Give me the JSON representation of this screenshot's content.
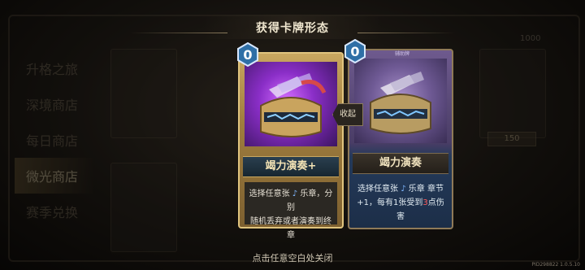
{
  "popup": {
    "title": "获得卡牌形态",
    "close_hint": "点击任意空白处关闭",
    "collapse_label": "收起"
  },
  "cards": [
    {
      "cost": "0",
      "name": "竭力演奏+",
      "description": [
        "选择任意张",
        "乐章，分别",
        "随机丢弃或者演奏到终章"
      ],
      "frame": "gold",
      "art_icon": "helmet-with-feathers"
    },
    {
      "cost": "0",
      "type_tag": "辅助牌",
      "name": "竭力演奏",
      "description": [
        "选择任意张",
        "乐章 章节",
        "+1，每有1张受到",
        "3",
        "点伤害"
      ],
      "frame": "silver",
      "art_icon": "helmet-with-feathers"
    }
  ],
  "background": {
    "sidebar": [
      "升格之旅",
      "深境商店",
      "每日商店",
      "微光商店",
      "赛季兑换"
    ],
    "active_sidebar": "微光商店",
    "top_labels": [
      "1000"
    ],
    "price_values": [
      "150"
    ]
  },
  "version": "PID298822 1.0.5.10",
  "colors": {
    "accent_gold": "#c9a760",
    "cost_gem": "#2f6fa6",
    "damage_red": "#ff5b5b"
  }
}
